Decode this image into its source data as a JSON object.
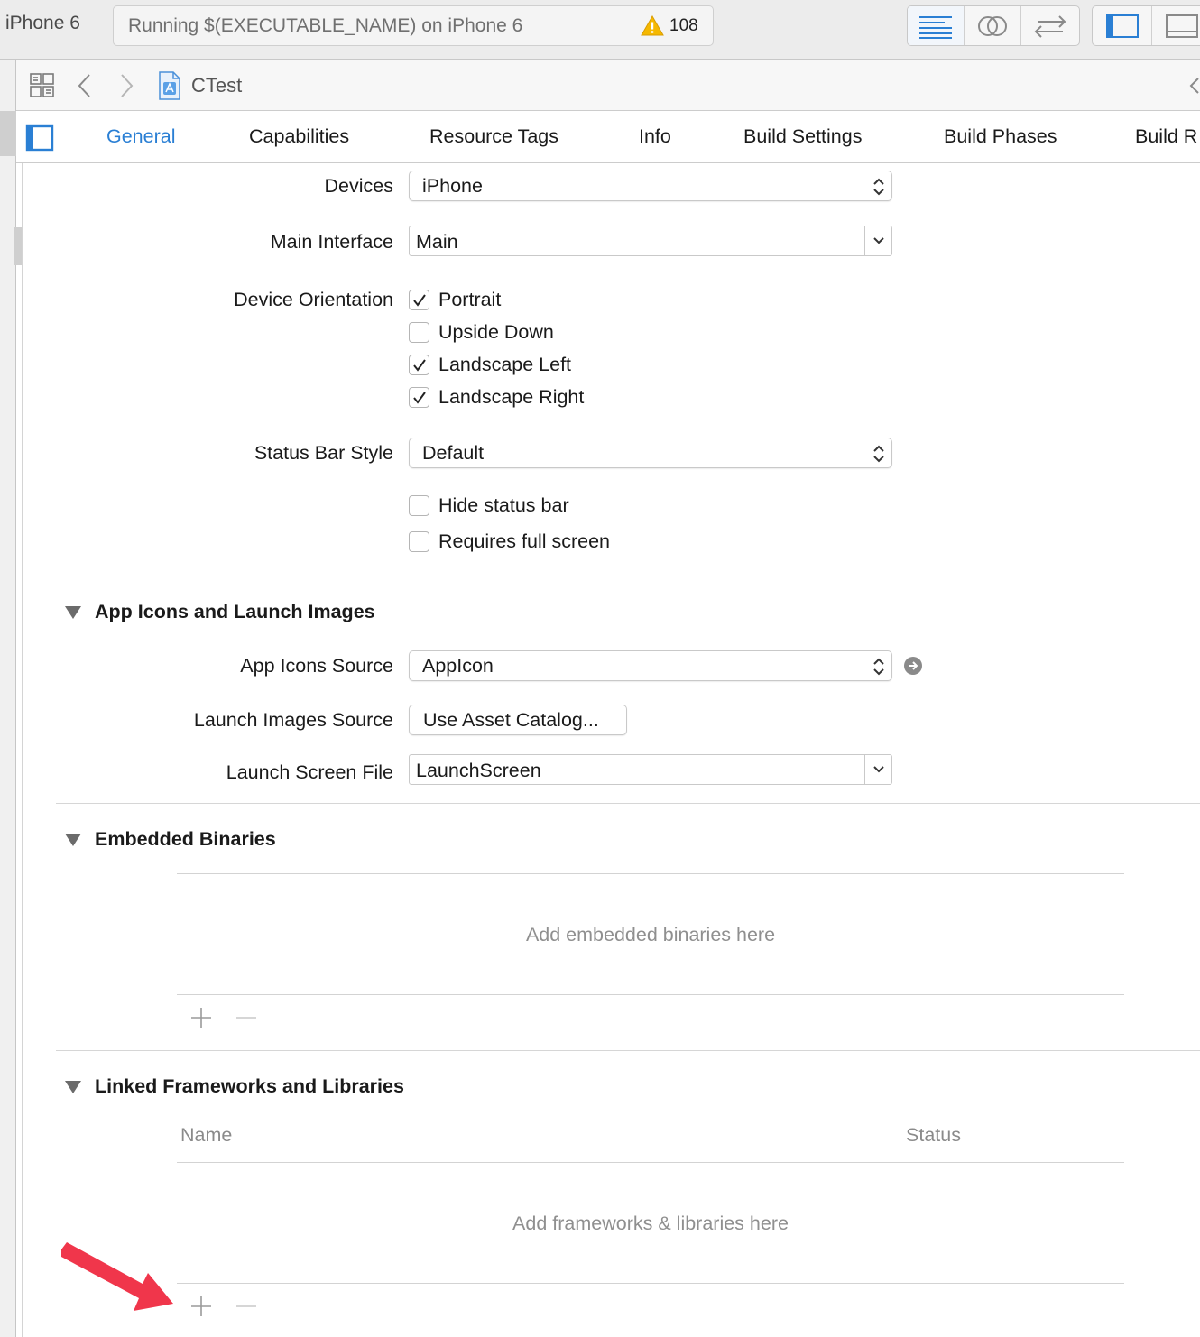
{
  "toolbar": {
    "scheme_device": "iPhone 6",
    "activity_text": "Running $(EXECUTABLE_NAME) on iPhone 6",
    "warning_count": "108",
    "warning_icon": "warning-triangle-icon",
    "editor_buttons": [
      "standard-editor-icon",
      "assistant-editor-icon",
      "version-editor-icon"
    ],
    "view_buttons": [
      "navigator-panel-icon",
      "debug-area-icon"
    ]
  },
  "jumpbar": {
    "project_name": "CTest",
    "icons": [
      "related-items-icon",
      "back-chevron-icon",
      "forward-chevron-icon",
      "project-file-icon"
    ]
  },
  "tabs": [
    {
      "label": "General",
      "active": true
    },
    {
      "label": "Capabilities"
    },
    {
      "label": "Resource Tags"
    },
    {
      "label": "Info"
    },
    {
      "label": "Build Settings"
    },
    {
      "label": "Build Phases"
    },
    {
      "label": "Build R"
    }
  ],
  "deployment": {
    "devices_label": "Devices",
    "devices_value": "iPhone",
    "main_interface_label": "Main Interface",
    "main_interface_value": "Main",
    "orientation_label": "Device Orientation",
    "orientations": [
      {
        "label": "Portrait",
        "checked": true
      },
      {
        "label": "Upside Down",
        "checked": false
      },
      {
        "label": "Landscape Left",
        "checked": true
      },
      {
        "label": "Landscape Right",
        "checked": true
      }
    ],
    "status_bar_label": "Status Bar Style",
    "status_bar_value": "Default",
    "hide_status_bar": {
      "label": "Hide status bar",
      "checked": false
    },
    "requires_full_screen": {
      "label": "Requires full screen",
      "checked": false
    }
  },
  "app_icons": {
    "title": "App Icons and Launch Images",
    "icons_source_label": "App Icons Source",
    "icons_source_value": "AppIcon",
    "launch_images_label": "Launch Images Source",
    "launch_images_button": "Use Asset Catalog...",
    "launch_screen_label": "Launch Screen File",
    "launch_screen_value": "LaunchScreen"
  },
  "embedded": {
    "title": "Embedded Binaries",
    "placeholder": "Add embedded binaries here"
  },
  "linked": {
    "title": "Linked Frameworks and Libraries",
    "col_name": "Name",
    "col_status": "Status",
    "placeholder": "Add frameworks & libraries here"
  },
  "colors": {
    "accent": "#2a7fd4",
    "annotation_arrow": "#f0364b"
  }
}
